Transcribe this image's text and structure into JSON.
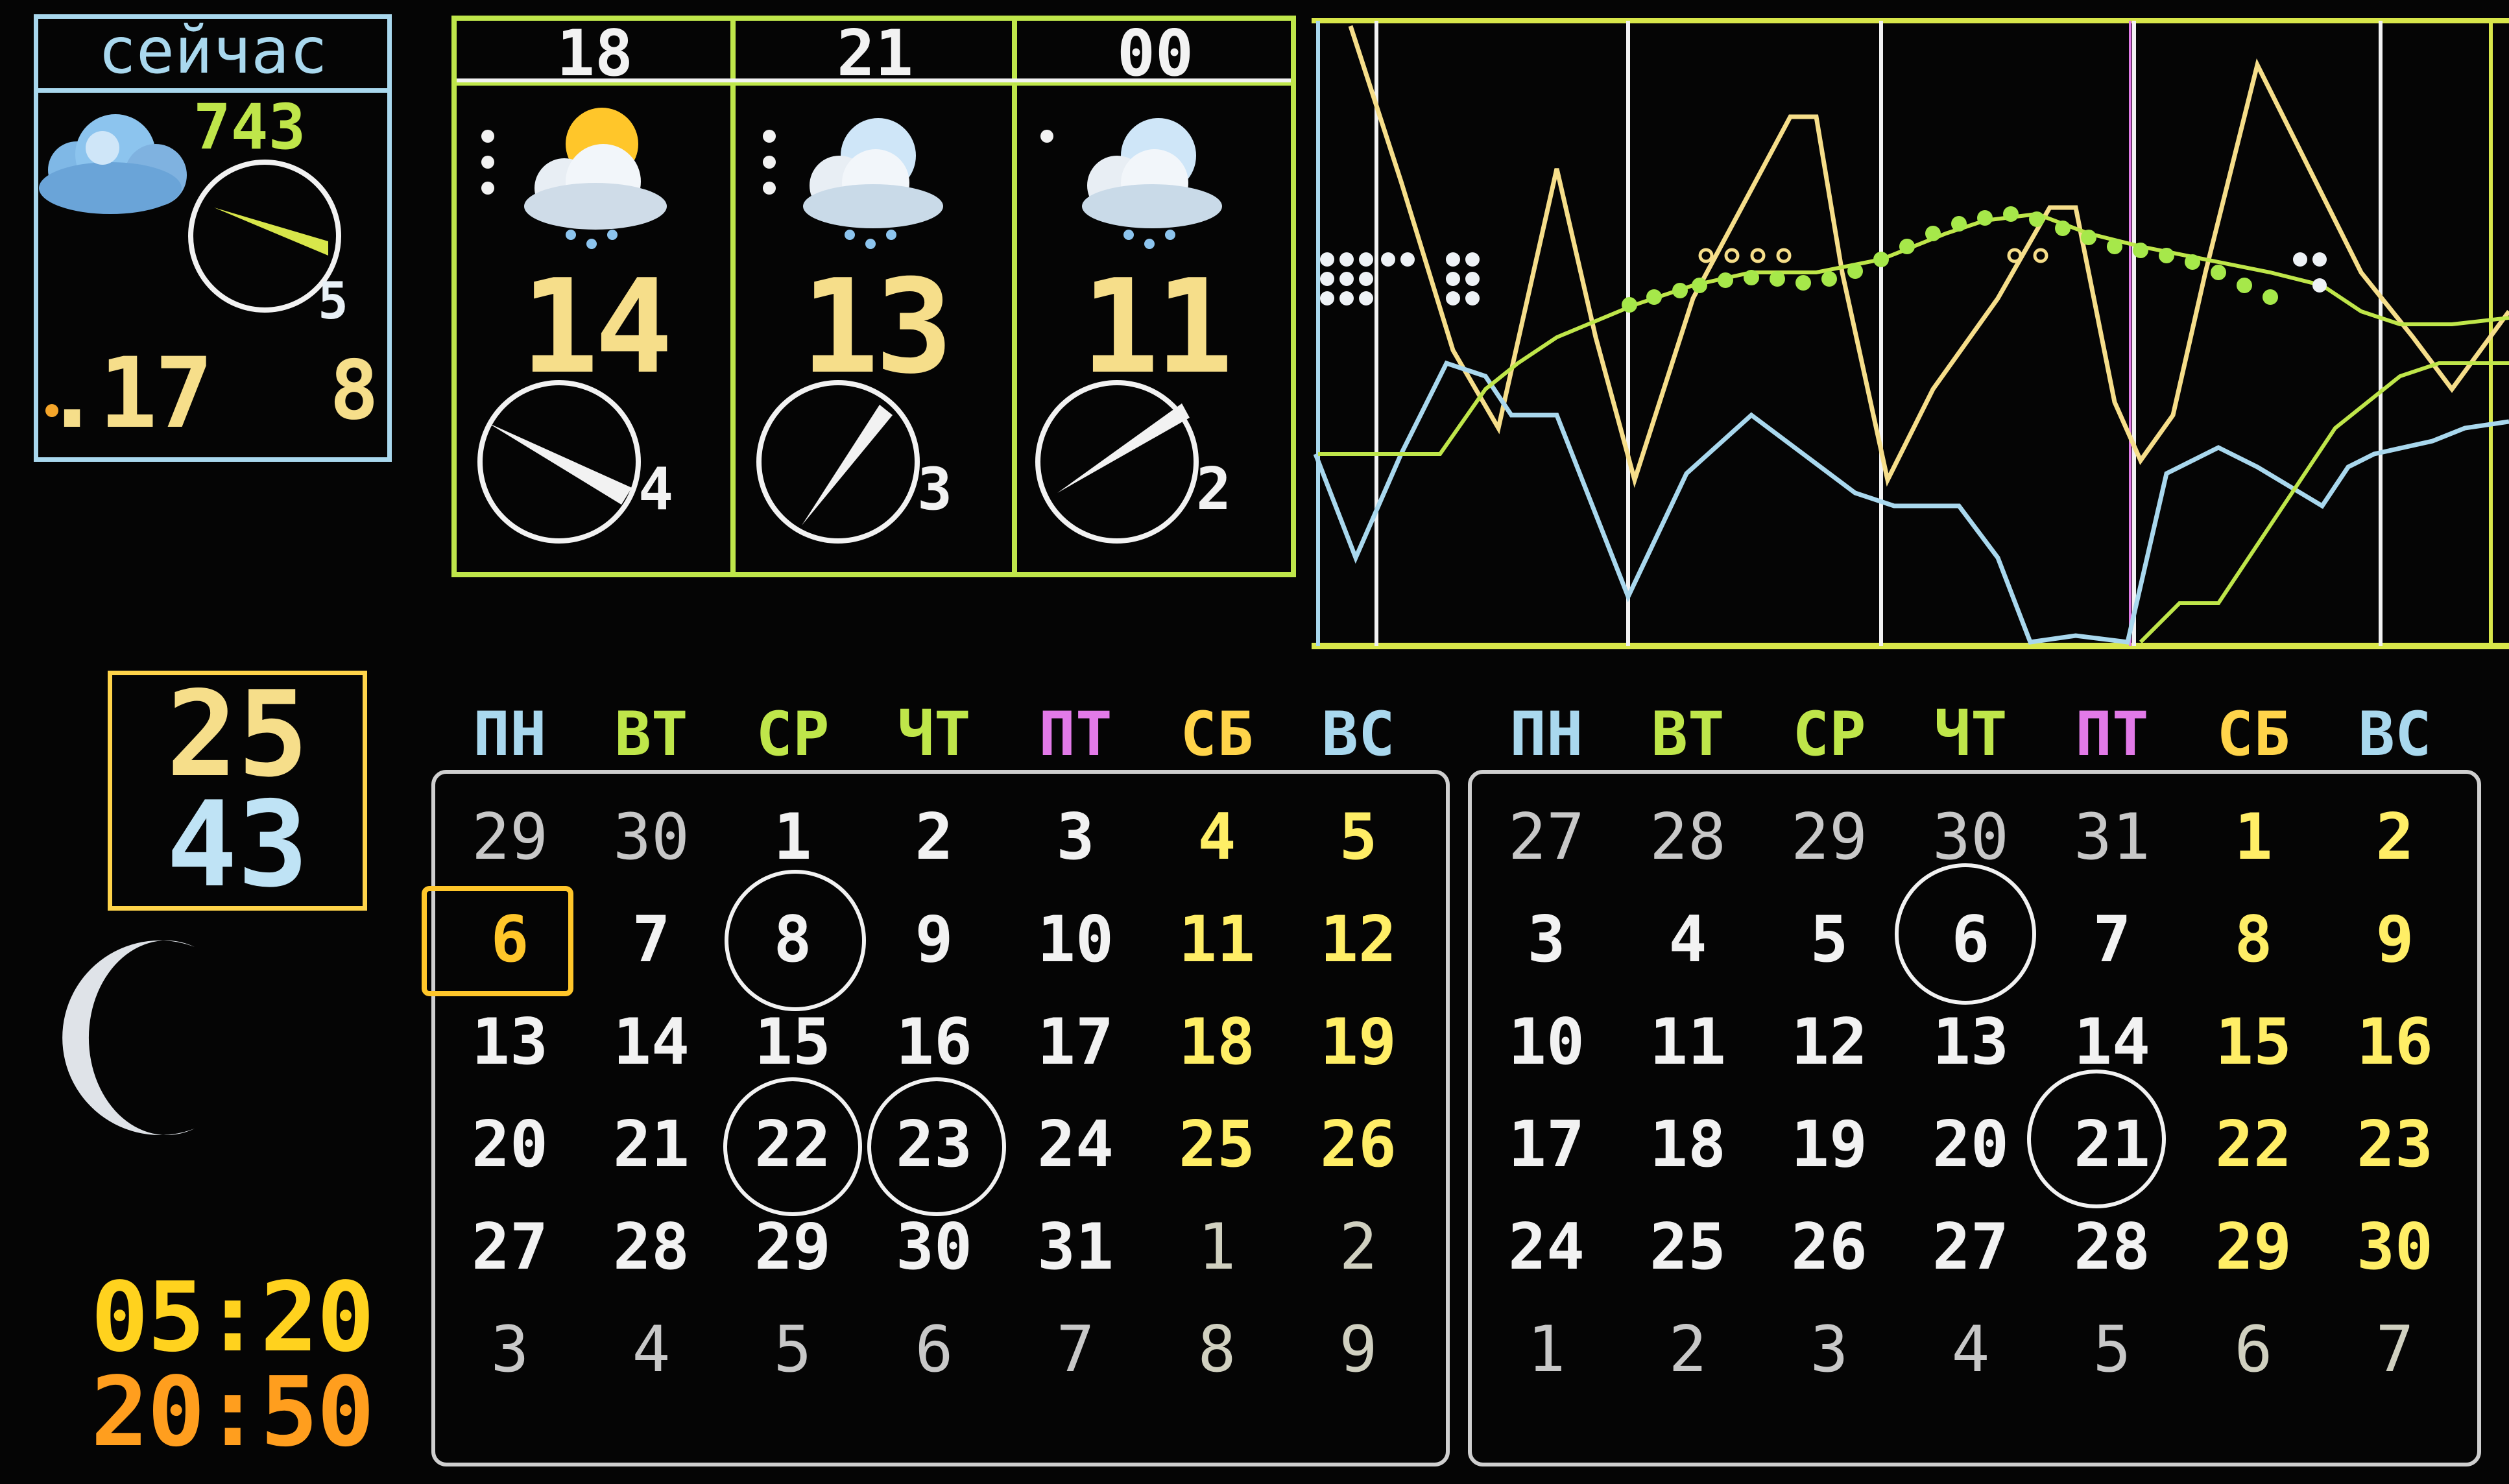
{
  "now": {
    "title": "сейчас",
    "pressure": "743",
    "wind_speed": "5",
    "temperature": ".17",
    "humidity": "8",
    "icon": "cloudy-icon"
  },
  "forecast": [
    {
      "hour": "18",
      "temperature": "14",
      "wind_speed": "4",
      "icon": "sun-cloud-rain-icon"
    },
    {
      "hour": "21",
      "temperature": "13",
      "wind_speed": "3",
      "icon": "moon-cloud-rain-icon"
    },
    {
      "hour": "00",
      "temperature": "11",
      "wind_speed": "2",
      "icon": "moon-cloud-rain-icon"
    }
  ],
  "sun": {
    "upper_value": "25",
    "lower_value": "43",
    "sunrise": "05:20",
    "sunset": "20:50"
  },
  "weekdays": [
    "ПН",
    "ВТ",
    "СР",
    "ЧТ",
    "ПТ",
    "СБ",
    "ВС"
  ],
  "calendar_current": {
    "weeks": [
      [
        "29",
        "30",
        "1",
        "2",
        "3",
        "4",
        "5"
      ],
      [
        "6",
        "7",
        "8",
        "9",
        "10",
        "11",
        "12"
      ],
      [
        "13",
        "14",
        "15",
        "16",
        "17",
        "18",
        "19"
      ],
      [
        "20",
        "21",
        "22",
        "23",
        "24",
        "25",
        "26"
      ],
      [
        "27",
        "28",
        "29",
        "30",
        "31",
        "1",
        "2"
      ],
      [
        "3",
        "4",
        "5",
        "6",
        "7",
        "8",
        "9"
      ]
    ],
    "today": "6",
    "circled": [
      "8",
      "22",
      "23"
    ]
  },
  "calendar_next": {
    "weeks": [
      [
        "27",
        "28",
        "29",
        "30",
        "31",
        "1",
        "2"
      ],
      [
        "3",
        "4",
        "5",
        "6",
        "7",
        "8",
        "9"
      ],
      [
        "10",
        "11",
        "12",
        "13",
        "14",
        "15",
        "16"
      ],
      [
        "17",
        "18",
        "19",
        "20",
        "21",
        "22",
        "23"
      ],
      [
        "24",
        "25",
        "26",
        "27",
        "28",
        "29",
        "30"
      ],
      [
        "1",
        "2",
        "3",
        "4",
        "5",
        "6",
        "7"
      ]
    ],
    "circled": [
      "6",
      "21"
    ]
  },
  "colors": {
    "weekday_headers": [
      "#a9d8ee",
      "#bfe64a",
      "#bfe64a",
      "#bfe64a",
      "#e27ae8",
      "#ffd44a",
      "#a9d8ee"
    ],
    "temperature_line": "#f6de8a",
    "humidity_line": "#a9d8ee",
    "pressure_line": "#bfe64a"
  }
}
